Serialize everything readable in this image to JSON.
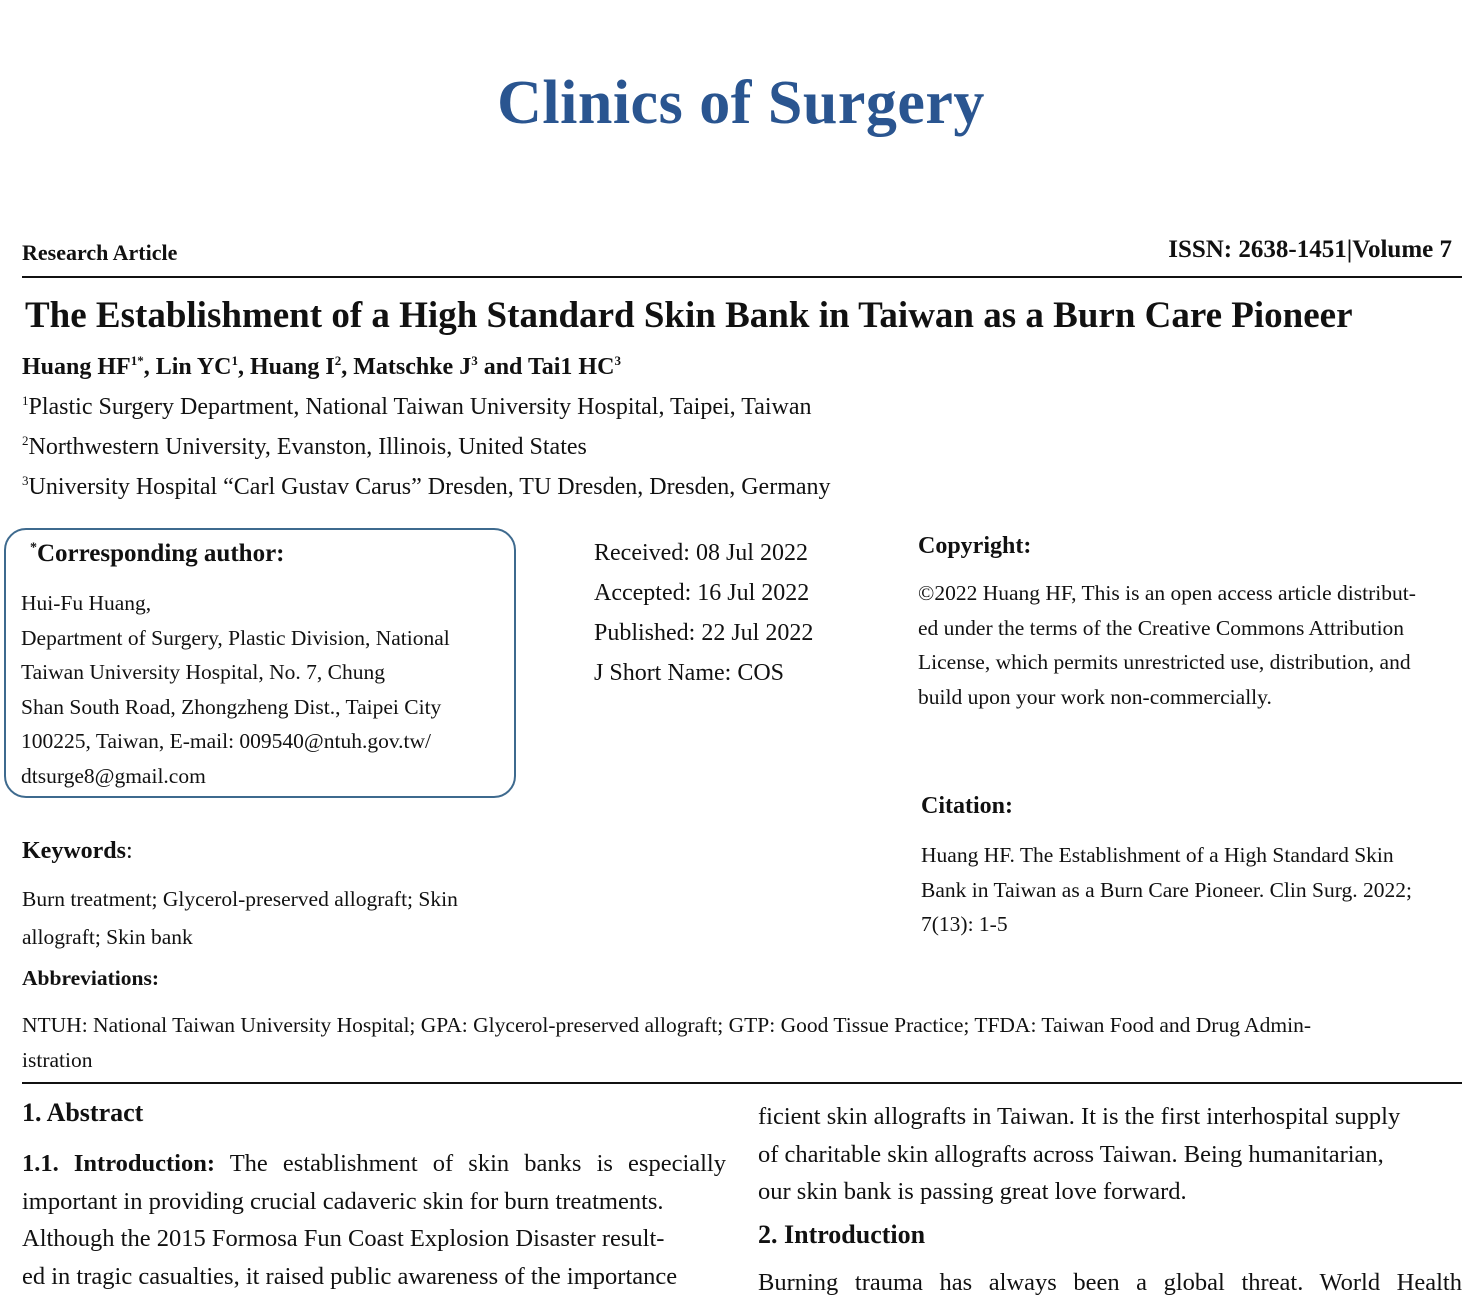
{
  "journal": "Clinics of  Surgery",
  "article_type": "Research Article",
  "issn": "ISSN: 2638-1451|Volume 7",
  "title": "The Establishment of a High Standard Skin Bank in Taiwan as a Burn Care Pioneer",
  "authors": [
    {
      "name": "Huang HF",
      "sup": "1*",
      "sep": ", "
    },
    {
      "name": "Lin YC",
      "sup": "1",
      "sep": ", "
    },
    {
      "name": "Huang I",
      "sup": "2",
      "sep": ", "
    },
    {
      "name": "Matschke J",
      "sup": "3",
      "sep": " and "
    },
    {
      "name": "Tai1 HC",
      "sup": "3",
      "sep": ""
    }
  ],
  "affiliations": [
    {
      "sup": "1",
      "text": "Plastic Surgery Department, National Taiwan University Hospital, Taipei, Taiwan"
    },
    {
      "sup": "2",
      "text": "Northwestern University, Evanston, Illinois, United States"
    },
    {
      "sup": "3",
      "text": "University Hospital “Carl Gustav Carus” Dresden, TU Dresden, Dresden, Germany"
    }
  ],
  "corresponding": {
    "star": "*",
    "title": "Corresponding author:",
    "lines": [
      "Hui-Fu Huang,",
      "Department of Surgery, Plastic Division, National",
      "Taiwan University Hospital, No. 7, Chung",
      "Shan South Road, Zhongzheng Dist., Taipei City",
      "100225,  Taiwan,  E-mail:  009540@ntuh.gov.tw/",
      "dtsurge8@gmail.com"
    ]
  },
  "dates": {
    "received": "Received: 08 Jul 2022",
    "accepted": "Accepted: 16 Jul 2022",
    "published": "Published: 22 Jul 2022",
    "short_name": "J Short Name: COS"
  },
  "copyright": {
    "title": "Copyright:",
    "lines": [
      "©2022 Huang HF, This is an open access article distribut-",
      "ed under the terms of the Creative Commons Attribution",
      "License, which permits unrestricted use, distribution, and",
      "build upon your work non-commercially."
    ]
  },
  "citation": {
    "title": "Citation:",
    "lines": [
      "Huang HF. The Establishment of a High Standard Skin",
      "Bank in Taiwan as a Burn Care Pioneer. Clin Surg. 2022;",
      "7(13): 1-5"
    ]
  },
  "keywords": {
    "title": "Keywords",
    "colon": ":",
    "lines": [
      "Burn treatment; Glycerol-preserved allograft; Skin",
      "allograft; Skin bank"
    ]
  },
  "abbreviations": {
    "title": "Abbreviations:",
    "lines": [
      "NTUH: National Taiwan University Hospital; GPA: Glycerol-preserved allograft; GTP: Good Tissue Practice; TFDA: Taiwan Food and Drug Admin-",
      "istration"
    ]
  },
  "abstract": {
    "heading": "1. Abstract",
    "intro_label": "1.1. Introduction:",
    "intro_first": "The establishment of skin banks is especially",
    "lines": [
      "important in providing crucial cadaveric skin for burn treatments.",
      "Although the 2015 Formosa Fun Coast Explosion Disaster result-",
      "ed in tragic casualties, it raised public awareness of the importance"
    ],
    "right_lines": [
      "ficient skin allografts in Taiwan. It is the first interhospital supply",
      "of charitable skin allografts across Taiwan. Being humanitarian,",
      "our skin bank is passing great love forward."
    ]
  },
  "introduction": {
    "heading": "2. Introduction",
    "first_line": "Burning trauma has always been a global threat. World Health"
  }
}
